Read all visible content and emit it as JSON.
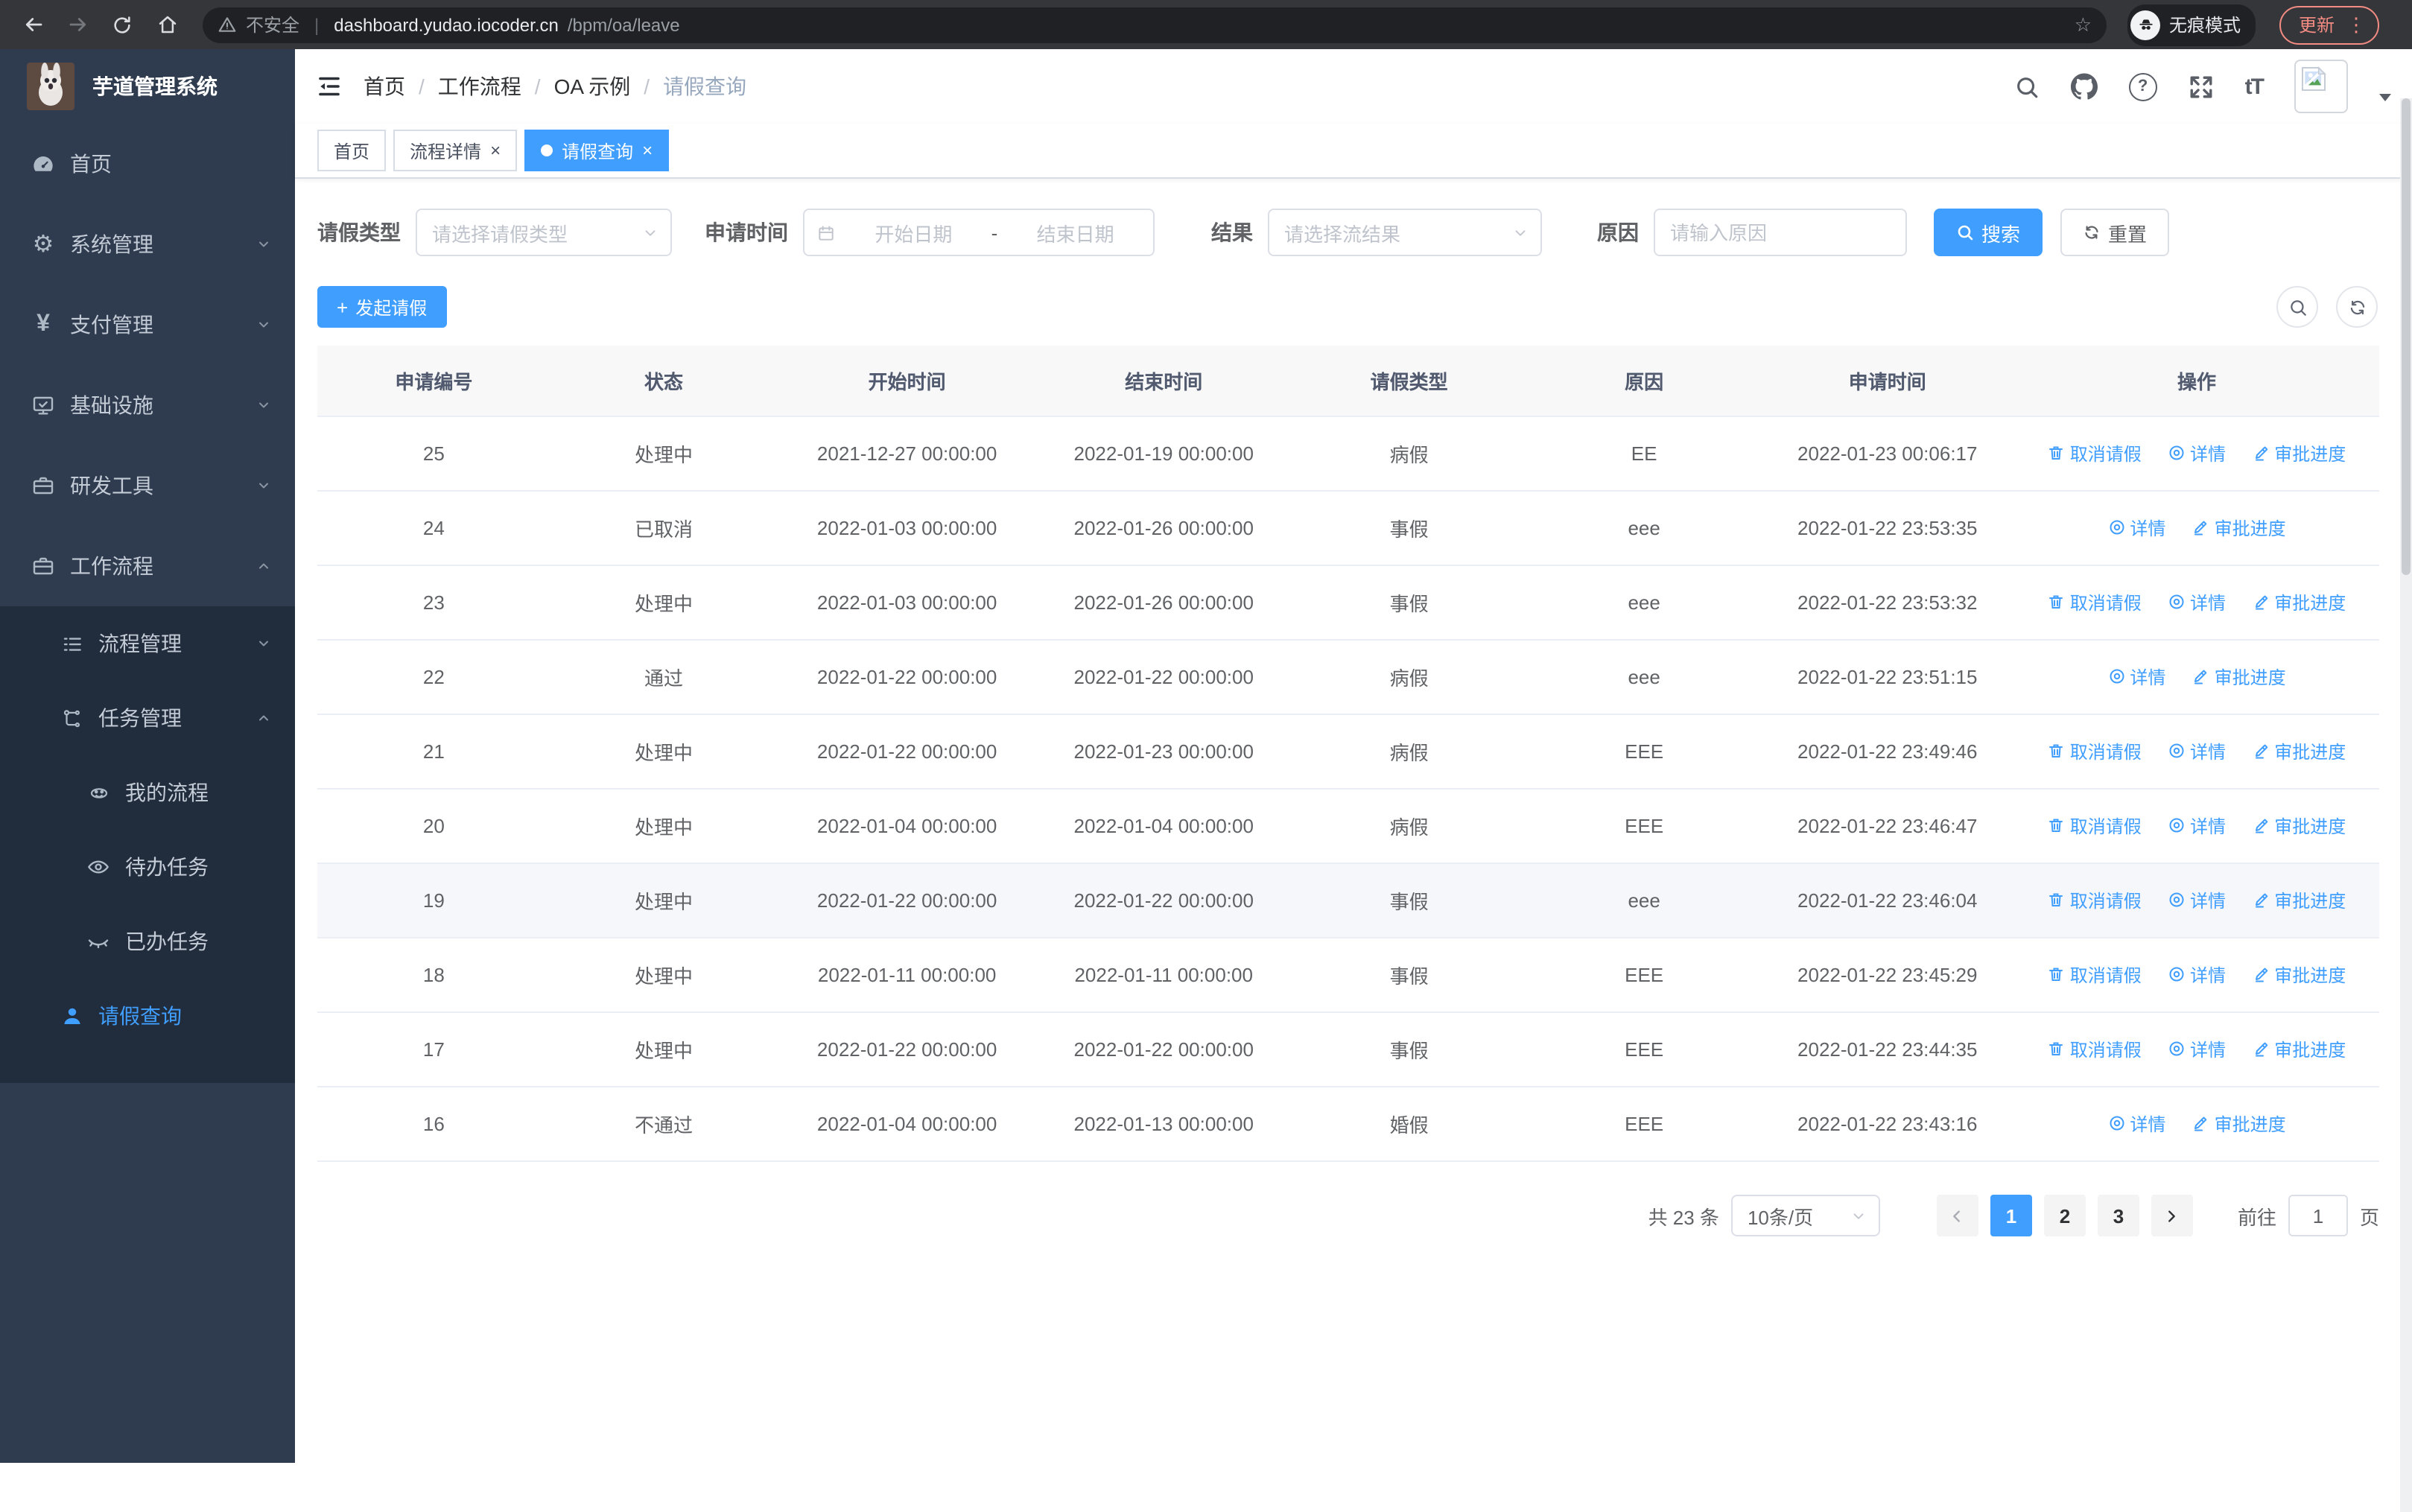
{
  "browser": {
    "security_label": "不安全",
    "url_host": "dashboard.yudao.iocoder.cn",
    "url_path": "/bpm/oa/leave",
    "incognito_label": "无痕模式",
    "update_label": "更新"
  },
  "icons": {
    "gear": "⚙",
    "yen": "¥",
    "star": "☆",
    "dots": "⋮",
    "question": "?",
    "font_size": "tT",
    "close": "×",
    "plus": "+"
  },
  "sidebar": {
    "title": "芋道管理系统",
    "items": [
      {
        "label": "首页"
      },
      {
        "label": "系统管理"
      },
      {
        "label": "支付管理"
      },
      {
        "label": "基础设施"
      },
      {
        "label": "研发工具"
      },
      {
        "label": "工作流程"
      },
      {
        "label": "流程管理"
      },
      {
        "label": "任务管理"
      },
      {
        "label": "我的流程"
      },
      {
        "label": "待办任务"
      },
      {
        "label": "已办任务"
      },
      {
        "label": "请假查询",
        "active": true
      }
    ]
  },
  "header": {
    "breadcrumb": [
      "首页",
      "工作流程",
      "OA 示例",
      "请假查询"
    ],
    "separator": "/",
    "tabs": [
      {
        "label": "首页",
        "closable": false,
        "active": false
      },
      {
        "label": "流程详情",
        "closable": true,
        "active": false
      },
      {
        "label": "请假查询",
        "closable": true,
        "active": true
      }
    ]
  },
  "filters": {
    "leave_type_label": "请假类型",
    "leave_type_placeholder": "请选择请假类型",
    "apply_time_label": "申请时间",
    "start_date_placeholder": "开始日期",
    "date_separator": "-",
    "end_date_placeholder": "结束日期",
    "result_label": "结果",
    "result_placeholder": "请选择流结果",
    "reason_label": "原因",
    "reason_placeholder": "请输入原因",
    "search_label": "搜索",
    "reset_label": "重置"
  },
  "toolbar": {
    "create_label": "发起请假"
  },
  "table": {
    "columns": [
      "申请编号",
      "状态",
      "开始时间",
      "结束时间",
      "请假类型",
      "原因",
      "申请时间",
      "操作"
    ],
    "action_labels": {
      "cancel": "取消请假",
      "detail": "详情",
      "progress": "审批进度"
    },
    "rows": [
      {
        "id": "25",
        "status": "处理中",
        "start": "2021-12-27 00:00:00",
        "end": "2022-01-19 00:00:00",
        "type": "病假",
        "reason": "EE",
        "applied": "2022-01-23 00:06:17",
        "cancelable": true
      },
      {
        "id": "24",
        "status": "已取消",
        "start": "2022-01-03 00:00:00",
        "end": "2022-01-26 00:00:00",
        "type": "事假",
        "reason": "eee",
        "applied": "2022-01-22 23:53:35",
        "cancelable": false
      },
      {
        "id": "23",
        "status": "处理中",
        "start": "2022-01-03 00:00:00",
        "end": "2022-01-26 00:00:00",
        "type": "事假",
        "reason": "eee",
        "applied": "2022-01-22 23:53:32",
        "cancelable": true
      },
      {
        "id": "22",
        "status": "通过",
        "start": "2022-01-22 00:00:00",
        "end": "2022-01-22 00:00:00",
        "type": "病假",
        "reason": "eee",
        "applied": "2022-01-22 23:51:15",
        "cancelable": false
      },
      {
        "id": "21",
        "status": "处理中",
        "start": "2022-01-22 00:00:00",
        "end": "2022-01-23 00:00:00",
        "type": "病假",
        "reason": "EEE",
        "applied": "2022-01-22 23:49:46",
        "cancelable": true
      },
      {
        "id": "20",
        "status": "处理中",
        "start": "2022-01-04 00:00:00",
        "end": "2022-01-04 00:00:00",
        "type": "病假",
        "reason": "EEE",
        "applied": "2022-01-22 23:46:47",
        "cancelable": true
      },
      {
        "id": "19",
        "status": "处理中",
        "start": "2022-01-22 00:00:00",
        "end": "2022-01-22 00:00:00",
        "type": "事假",
        "reason": "eee",
        "applied": "2022-01-22 23:46:04",
        "cancelable": true,
        "highlighted": true
      },
      {
        "id": "18",
        "status": "处理中",
        "start": "2022-01-11 00:00:00",
        "end": "2022-01-11 00:00:00",
        "type": "事假",
        "reason": "EEE",
        "applied": "2022-01-22 23:45:29",
        "cancelable": true
      },
      {
        "id": "17",
        "status": "处理中",
        "start": "2022-01-22 00:00:00",
        "end": "2022-01-22 00:00:00",
        "type": "事假",
        "reason": "EEE",
        "applied": "2022-01-22 23:44:35",
        "cancelable": true
      },
      {
        "id": "16",
        "status": "不通过",
        "start": "2022-01-04 00:00:00",
        "end": "2022-01-13 00:00:00",
        "type": "婚假",
        "reason": "EEE",
        "applied": "2022-01-22 23:43:16",
        "cancelable": false
      }
    ]
  },
  "pagination": {
    "total_label": "共 23 条",
    "page_size": "10条/页",
    "pages": [
      "1",
      "2",
      "3"
    ],
    "active_page": "1",
    "goto_label": "前往",
    "goto_value": "1",
    "page_unit": "页"
  },
  "colors": {
    "primary": "#409eff",
    "sidebar_bg": "#2f3b4e",
    "submenu_bg": "#212c3c",
    "update_accent": "#f28b82"
  }
}
